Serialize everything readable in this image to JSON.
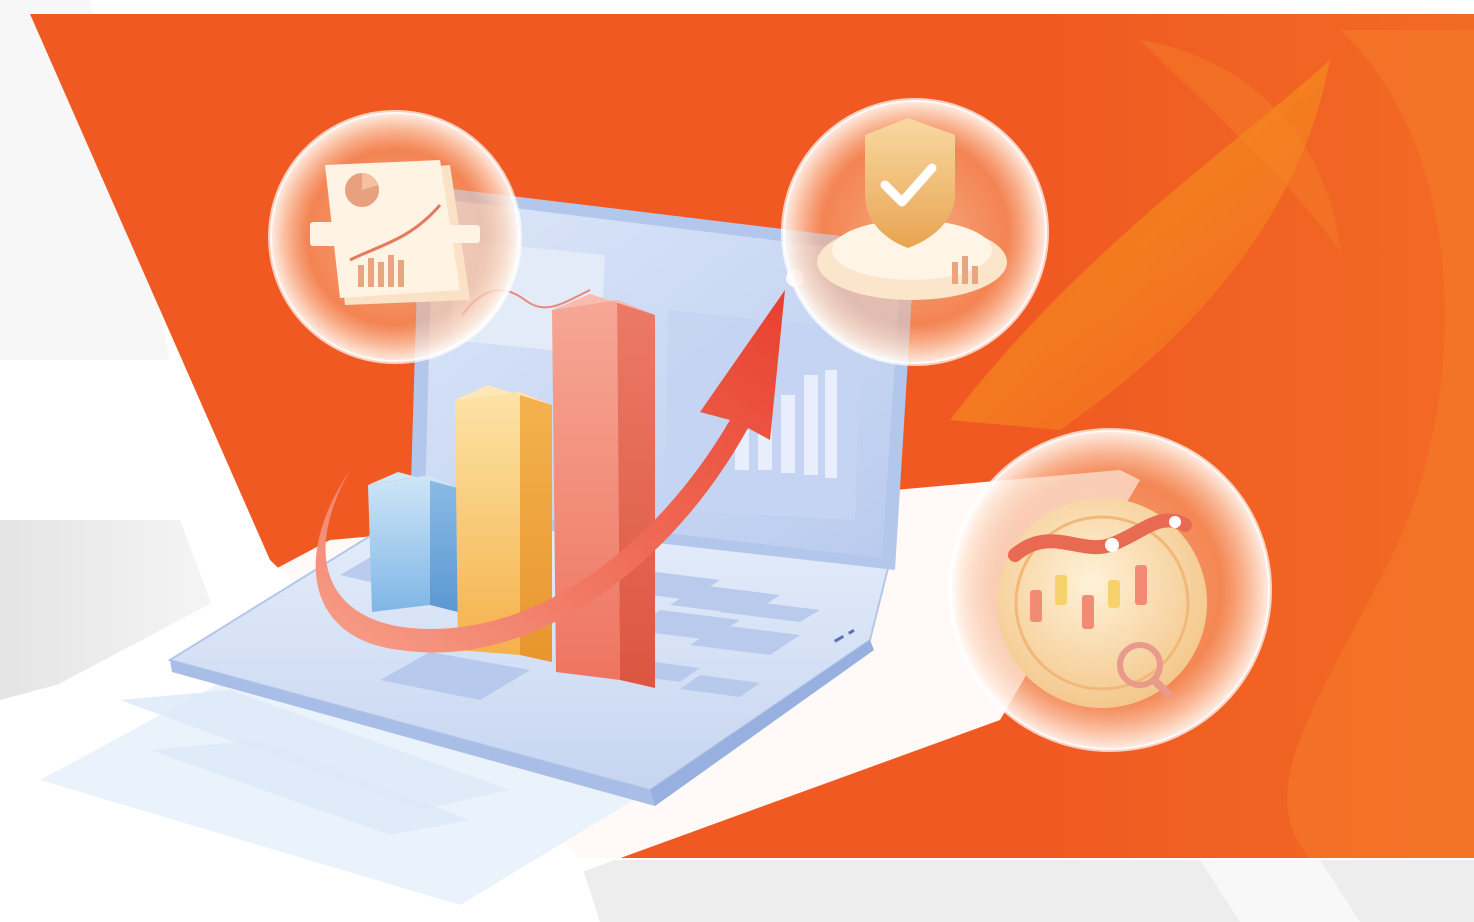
{
  "illustration": {
    "subject": "laptop-with-growth-bar-chart-and-rising-arrow",
    "colors": {
      "banner_orange": "#F05A22",
      "banner_orange_light": "#F58A2A",
      "background_white": "#FFFFFF",
      "background_gray": "#EDEDED",
      "laptop_body": "#D7E3F7",
      "laptop_screen": "#C9D7F1",
      "bar_blue": "#8FC3EC",
      "bar_yellow": "#F7B64A",
      "bar_red": "#EE7561",
      "arrow_red": "#E8493A"
    },
    "bars": [
      {
        "name": "blue",
        "value": 1
      },
      {
        "name": "yellow",
        "value": 2
      },
      {
        "name": "red",
        "value": 3
      }
    ],
    "bubbles": [
      {
        "name": "report-document-icon"
      },
      {
        "name": "security-shield-check-icon"
      },
      {
        "name": "candlestick-analysis-search-icon"
      }
    ]
  }
}
